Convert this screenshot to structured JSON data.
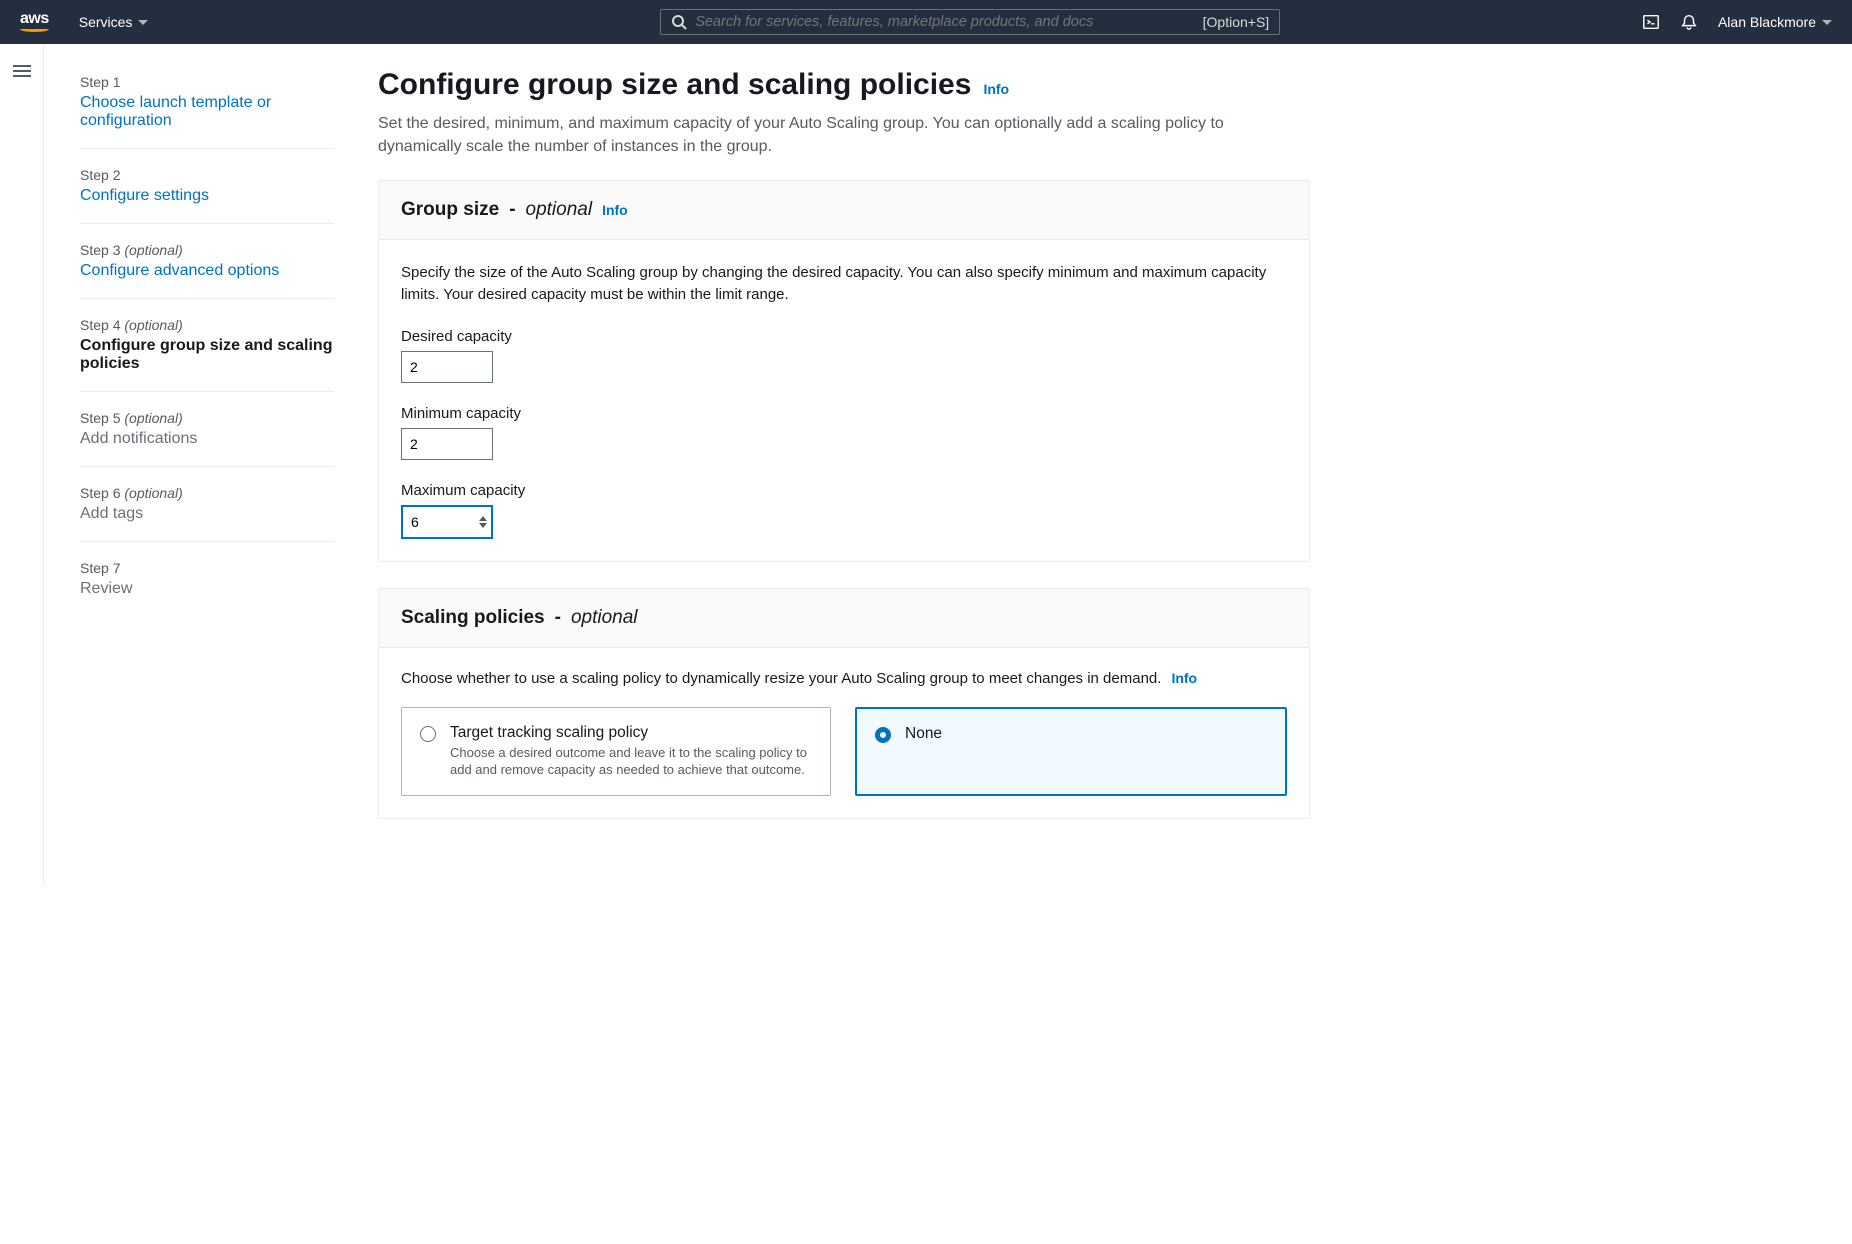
{
  "nav": {
    "services": "Services",
    "search_placeholder": "Search for services, features, marketplace products, and docs",
    "search_shortcut": "[Option+S]",
    "username": "Alan Blackmore"
  },
  "steps": [
    {
      "label": "Step 1",
      "optional": "",
      "title": "Choose launch template or configuration",
      "state": "link"
    },
    {
      "label": "Step 2",
      "optional": "",
      "title": "Configure settings",
      "state": "link"
    },
    {
      "label": "Step 3",
      "optional": "(optional)",
      "title": "Configure advanced options",
      "state": "link"
    },
    {
      "label": "Step 4",
      "optional": "(optional)",
      "title": "Configure group size and scaling policies",
      "state": "current"
    },
    {
      "label": "Step 5",
      "optional": "(optional)",
      "title": "Add notifications",
      "state": "disabled"
    },
    {
      "label": "Step 6",
      "optional": "(optional)",
      "title": "Add tags",
      "state": "disabled"
    },
    {
      "label": "Step 7",
      "optional": "",
      "title": "Review",
      "state": "disabled"
    }
  ],
  "page": {
    "title": "Configure group size and scaling policies",
    "info": "Info",
    "description": "Set the desired, minimum, and maximum capacity of your Auto Scaling group. You can optionally add a scaling policy to dynamically scale the number of instances in the group."
  },
  "group_size": {
    "heading": "Group size",
    "dash": " - ",
    "optional": "optional",
    "info": "Info",
    "description": "Specify the size of the Auto Scaling group by changing the desired capacity. You can also specify minimum and maximum capacity limits. Your desired capacity must be within the limit range.",
    "desired_label": "Desired capacity",
    "desired_value": "2",
    "min_label": "Minimum capacity",
    "min_value": "2",
    "max_label": "Maximum capacity",
    "max_value": "6"
  },
  "scaling_policies": {
    "heading": "Scaling policies",
    "dash": " - ",
    "optional": "optional",
    "description": "Choose whether to use a scaling policy to dynamically resize your Auto Scaling group to meet changes in demand.",
    "info": "Info",
    "tile_target_title": "Target tracking scaling policy",
    "tile_target_desc": "Choose a desired outcome and leave it to the scaling policy to add and remove capacity as needed to achieve that outcome.",
    "tile_none_title": "None"
  }
}
